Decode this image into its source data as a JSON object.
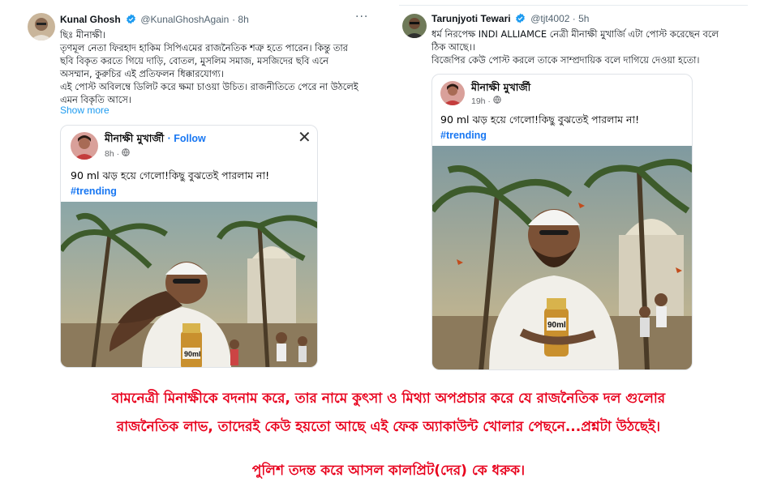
{
  "tweet_left": {
    "author_name": "Kunal Ghosh",
    "author_handle": "@KunalGhoshAgain",
    "time": "· 8h",
    "lines": [
      "ছিঃ মীনাক্ষী।",
      "তৃণমূল নেতা ফিরহাদ হাকিম সিপিএমের রাজনৈতিক শত্রু হতে পারেন। কিন্তু তার",
      "ছবি বিকৃত করতে গিয়ে দাড়ি, বোতল, মুসলিম সমাজ, মসজিদের ছবি এনে",
      "অসম্মান, কুরুচির এই প্রতিফলন ধিক্কারযোগ্য।",
      "এই পোস্ট অবিলম্বে ডিলিট করে ক্ষমা চাওয়া উচিত। রাজনীতিতে পেরে না উঠলেই",
      "এমন বিকৃতি আসে।"
    ],
    "show_more": "Show more",
    "fb_post": {
      "author": "মীনাক্ষী মুখার্জী",
      "follow": "· Follow",
      "time": "8h ·",
      "text": "90 ml  ঝড় হয়ে গেলো!কিছু বুঝতেই পারলাম না!",
      "hashtag": "#trending",
      "bottle_label": "90ml"
    }
  },
  "tweet_right": {
    "author_name": "Tarunjyoti Tewari",
    "author_handle": "@tjt4002 · 5h",
    "lines": [
      "ধর্ম নিরপেক্ষ INDI ALLIAMCE নেত্রী মীনাক্ষী মুখার্জি এটা পোস্ট করেছেন বলে",
      "ঠিক আছে।।",
      "বিজেপির কেউ পোস্ট করলে তাকে সাম্প্রদায়িক বলে দাগিয়ে দেওয়া হতো।"
    ],
    "fb_post": {
      "author": "মীনাক্ষী মুখার্জী",
      "time": "19h ·",
      "text": "90 ml  ঝড় হয়ে গেলো!কিছু বুঝতেই পারলাম না!",
      "hashtag": "#trending",
      "bottle_label": "90ml"
    }
  },
  "caption": {
    "line1": "বামনেত্রী মিনাক্ষীকে বদনাম করে, তার নামে কুৎসা ও মিথ্যা অপপ্রচার করে যে রাজনৈতিক দল গুলোর",
    "line2": "রাজনৈতিক লাভ, তাদেরই কেউ হয়তো আছে এই ফেক অ্যাকাউন্ট খোলার পেছনে...প্রশ্নটা উঠছেই।",
    "line3": "পুলিশ তদন্ত করে আসল কালপ্রিট(দের) কে ধরুক।"
  },
  "colors": {
    "caption_red": "#e8001c",
    "link_blue": "#1d9bf0",
    "facebook_blue": "#1877f2",
    "verified_blue": "#1d9bf0"
  }
}
